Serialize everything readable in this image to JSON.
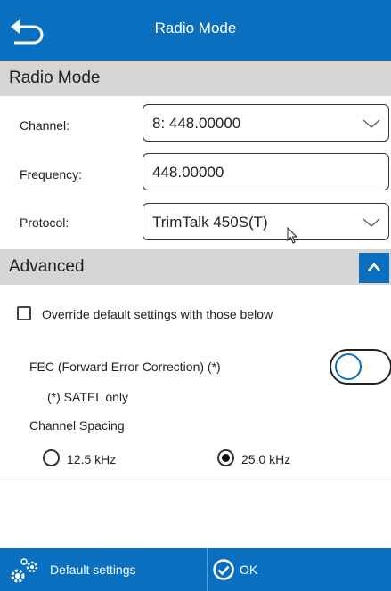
{
  "header": {
    "title": "Radio Mode"
  },
  "radio_section": {
    "title": "Radio Mode",
    "channel": {
      "label": "Channel:",
      "value": "8: 448.00000"
    },
    "frequency": {
      "label": "Frequency:",
      "value": "448.00000"
    },
    "protocol": {
      "label": "Protocol:",
      "value": "TrimTalk 450S(T)"
    }
  },
  "advanced_section": {
    "title": "Advanced",
    "override_label": "Override default settings with those below",
    "override_checked": false,
    "fec_label": "FEC (Forward Error Correction) (*)",
    "fec_on": false,
    "satel_note": "(*) SATEL only",
    "spacing_label": "Channel Spacing",
    "spacing_options": [
      {
        "label": "12.5 kHz",
        "selected": false
      },
      {
        "label": "25.0 kHz",
        "selected": true
      }
    ]
  },
  "footer": {
    "default_label": "Default settings",
    "ok_label": "OK"
  },
  "colors": {
    "accent": "#0a6fbf",
    "section_bg": "#d5d5d5"
  },
  "icons": [
    "back-icon",
    "chevron-down-icon",
    "chevron-up-icon",
    "gears-icon",
    "check-circle-icon",
    "mouse-cursor-icon"
  ]
}
